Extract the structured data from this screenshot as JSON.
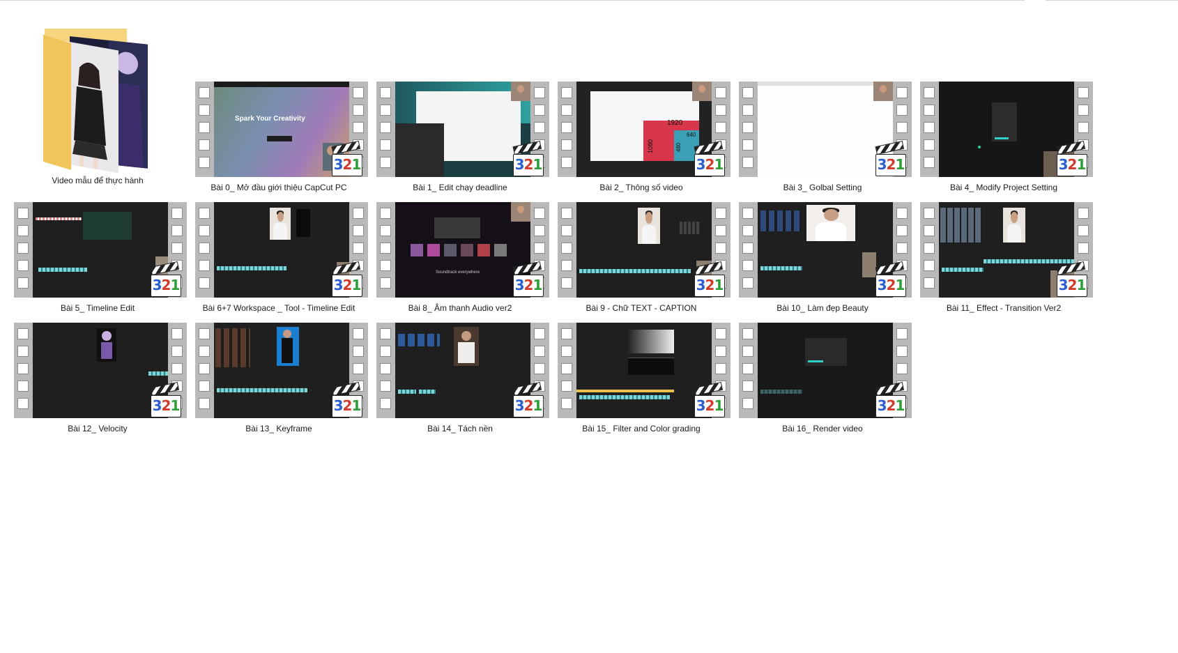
{
  "window": {
    "title": ""
  },
  "folder": {
    "label": "Video mẫu để thực hành",
    "icon": "folder-icon"
  },
  "files": [
    {
      "label": "Bài 0_ Mở đầu giới thiệu CapCut PC",
      "thumb_text": "Spark Your Creativity"
    },
    {
      "label": "Bài 1_ Edit chạy deadline"
    },
    {
      "label": "Bài 2_ Thông số video",
      "thumb_values": [
        "1920",
        "1080",
        "640",
        "480"
      ]
    },
    {
      "label": "Bài 3_ Golbal Setting"
    },
    {
      "label": "Bài 4_ Modify Project Setting"
    },
    {
      "label": "Bài 5_ Timeline Edit"
    },
    {
      "label": "Bài 6+7 Workspace _ Tool - Timeline Edit"
    },
    {
      "label": "Bài 8_ Âm thanh Audio ver2",
      "thumb_text": "Soundtrack everywhere"
    },
    {
      "label": "Bài 9 - Chữ TEXT - CAPTION"
    },
    {
      "label": "Bài 10_ Làm đẹp Beauty"
    },
    {
      "label": "Bài 11_ Effect - Transition Ver2"
    },
    {
      "label": "Bài 12_ Velocity"
    },
    {
      "label": "Bài 13_ Keyframe"
    },
    {
      "label": "Bài 14_ Tách nền"
    },
    {
      "label": "Bài 15_ Filter and Color grading"
    },
    {
      "label": "Bài 16_ Render video"
    }
  ],
  "badge": {
    "text_3": "3",
    "text_2": "2",
    "text_1": "1",
    "icon": "mpc-clapperboard-icon"
  },
  "colors": {
    "film": "#b9b9b9",
    "timeline": "#7dd5d8",
    "badge_blue": "#2b5fd0",
    "badge_red": "#d23b2b",
    "badge_green": "#2f9e3a"
  }
}
